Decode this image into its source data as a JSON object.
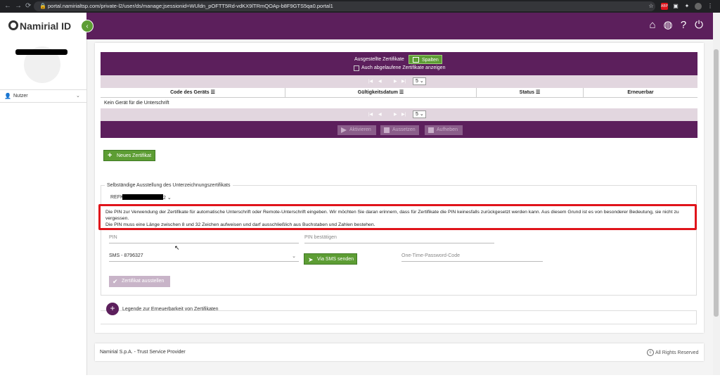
{
  "browser": {
    "url": "portal.namirialtsp.com/private-l2/user/ds/manage;jsessionid=WUldn_pOFTT5Rd-vdKX9lTRmQOAp-b8F9GTS5qa0.portal1"
  },
  "header": {
    "logo_text": "Namirial ID"
  },
  "sidebar": {
    "nav_users_label": "Nutzer"
  },
  "cert_table": {
    "title": "Ausgestellte Zertifikate",
    "columns_button": "Spalten",
    "show_expired_label": "Auch abgelaufene Zertifikate anzeigen",
    "page_size": "5",
    "headers": [
      "Code des Geräts",
      "Gültigkeitsdatum",
      "Status",
      "Erneuerbar"
    ],
    "empty_text": "Kein Gerät für die Unterschrift",
    "actions": [
      "Aktivieren",
      "Aussetzen",
      "Aufheben"
    ]
  },
  "new_cert_button": "Neues Zertifikat",
  "self_issue": {
    "legend": "Selbständige Ausstellung des Unterzeichnungszertifikats",
    "ref_prefix": "REFK",
    "ref_suffix": "2",
    "notice_line1": "Die PIN zur Verwendung der Zertifikate für automatische Unterschrift oder Remote-Unterschrift eingeben. Wir möchten Sie daran erinnern, dass für Zertifikate die PIN keinesfalls zurückgesetzt werden kann. Aus diesem Grund ist es von besonderer Bedeutung, sie nicht zu vergessen.",
    "notice_line2": "Die PIN muss eine Länge zwischen 8 und 32 Zeichen aufweisen und darf ausschließlich aus Buchstaben und Zahlen bestehen.",
    "pin_placeholder": "PIN",
    "pin_confirm_placeholder": "PIN bestätigen",
    "sms_option": "SMS - 8796327",
    "sms_button": "Via SMS senden",
    "otp_placeholder": "One-Time-Password-Code",
    "issue_button": "Zertifikat ausstellen",
    "legend_renew": "Legende zur Erneuerbarkeit von Zertifikaten"
  },
  "footer": {
    "left": "Namirial S.p.A. - Trust Service Provider",
    "right": "All Rights Reserved"
  },
  "colors": {
    "brand_purple": "#5c1f5c",
    "brand_green": "#5d9d34",
    "alert_red": "#e0141b"
  }
}
